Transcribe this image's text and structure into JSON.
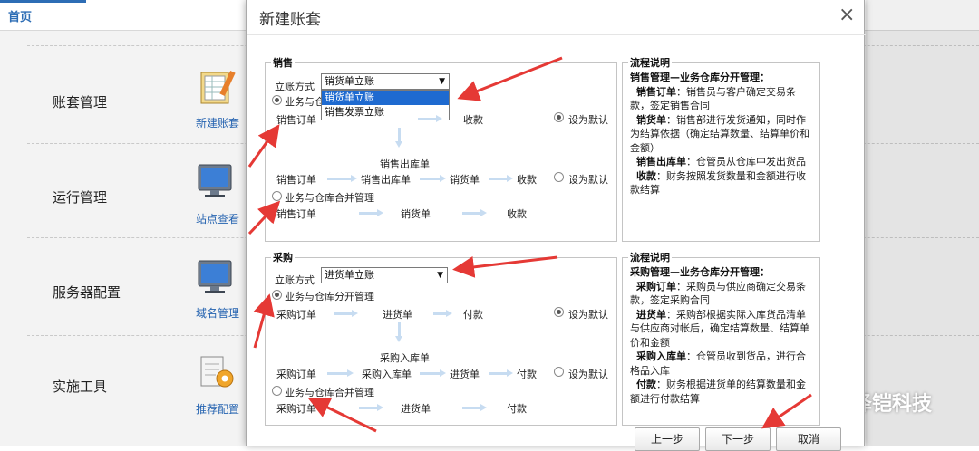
{
  "topbar": {
    "home_tab": "首页"
  },
  "sections": [
    {
      "label": "账套管理",
      "link": "新建账套",
      "icon": "ledger-icon"
    },
    {
      "label": "运行管理",
      "link": "站点查看",
      "icon": "monitor-icon"
    },
    {
      "label": "服务器配置",
      "link": "域名管理",
      "icon": "monitor-icon"
    },
    {
      "label": "实施工具",
      "link": "推荐配置",
      "icon": "gear-document-icon"
    }
  ],
  "dialog": {
    "title": "新建账套",
    "close": "×",
    "sales": {
      "legend": "销售",
      "method_label": "立账方式",
      "method_value": "销货单立账",
      "options": [
        "销货单立账",
        "销售发票立账"
      ],
      "separate_option": "业务与仓库分开管理",
      "merged_option": "业务与仓库合并管理",
      "default_label": "设为默认",
      "flow1": [
        "销售订单",
        "收款"
      ],
      "mid_node": "销售出库单",
      "flow2": [
        "销售订单",
        "销售出库单",
        "销货单",
        "收款"
      ],
      "flow3": [
        "销售订单",
        "销货单",
        "收款"
      ]
    },
    "sales_desc": {
      "legend": "流程说明",
      "heading": "销售管理—业务仓库分开管理：",
      "items": [
        {
          "term": "销售订单",
          "text": "：销售员与客户确定交易条款，签定销售合同"
        },
        {
          "term": "销货单",
          "text": "：销售部进行发货通知，同时作为结算依据（确定结算数量、结算单价和金额）"
        },
        {
          "term": "销售出库单",
          "text": "：仓管员从仓库中发出货品"
        },
        {
          "term": "收款",
          "text": "：财务按照发货数量和金额进行收款结算"
        }
      ]
    },
    "purchase": {
      "legend": "采购",
      "method_label": "立账方式",
      "method_value": "进货单立账",
      "separate_option": "业务与仓库分开管理",
      "merged_option": "业务与仓库合并管理",
      "default_label": "设为默认",
      "flow1": [
        "采购订单",
        "进货单",
        "付款"
      ],
      "mid_node": "采购入库单",
      "flow2": [
        "采购订单",
        "采购入库单",
        "进货单",
        "付款"
      ],
      "flow3": [
        "采购订单",
        "进货单",
        "付款"
      ]
    },
    "purchase_desc": {
      "legend": "流程说明",
      "heading": "采购管理—业务仓库分开管理：",
      "items": [
        {
          "term": "采购订单",
          "text": "：采购员与供应商确定交易条款，签定采购合同"
        },
        {
          "term": "进货单",
          "text": "：采购部根据实际入库货品清单与供应商对帐后，确定结算数量、结算单价和金额"
        },
        {
          "term": "采购入库单",
          "text": "：仓管员收到货品，进行合格品入库"
        },
        {
          "term": "付款",
          "text": "：财务根据进货单的结算数量和金额进行付款结算"
        }
      ]
    },
    "buttons": {
      "prev": "上一步",
      "next": "下一步",
      "cancel": "取消"
    }
  },
  "watermark": "泽铠科技",
  "colors": {
    "accent": "#2d6db5",
    "arrow_red": "#e53935",
    "flow_arrow": "#c7dcf1",
    "selected_option": "#1e6ad0"
  }
}
